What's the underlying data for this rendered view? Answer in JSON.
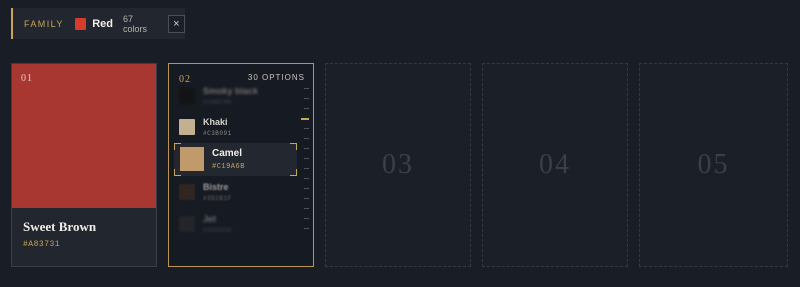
{
  "family": {
    "label": "FAMILY",
    "name": "Red",
    "swatch_color": "#d63a2a",
    "count": "67 colors",
    "close_label": "×"
  },
  "slots": [
    {
      "num": "01",
      "name": "Sweet Brown",
      "hex": "#A83731",
      "color": "#a83731"
    },
    {
      "num": "02",
      "options_label": "30 OPTIONS",
      "options": [
        {
          "name": "Smoky black",
          "hex": "#100C08",
          "color": "#100c08"
        },
        {
          "name": "Khaki",
          "hex": "#C3B091",
          "color": "#c3b091"
        },
        {
          "name": "Camel",
          "hex": "#C19A6B",
          "color": "#c19a6b",
          "selected": true
        },
        {
          "name": "Bistre",
          "hex": "#3D2B1F",
          "color": "#3d2b1f"
        },
        {
          "name": "Jet",
          "hex": "#343434",
          "color": "#343434"
        }
      ]
    },
    {
      "num": "03"
    },
    {
      "num": "04"
    },
    {
      "num": "05"
    }
  ],
  "accent": "#c9a45a"
}
